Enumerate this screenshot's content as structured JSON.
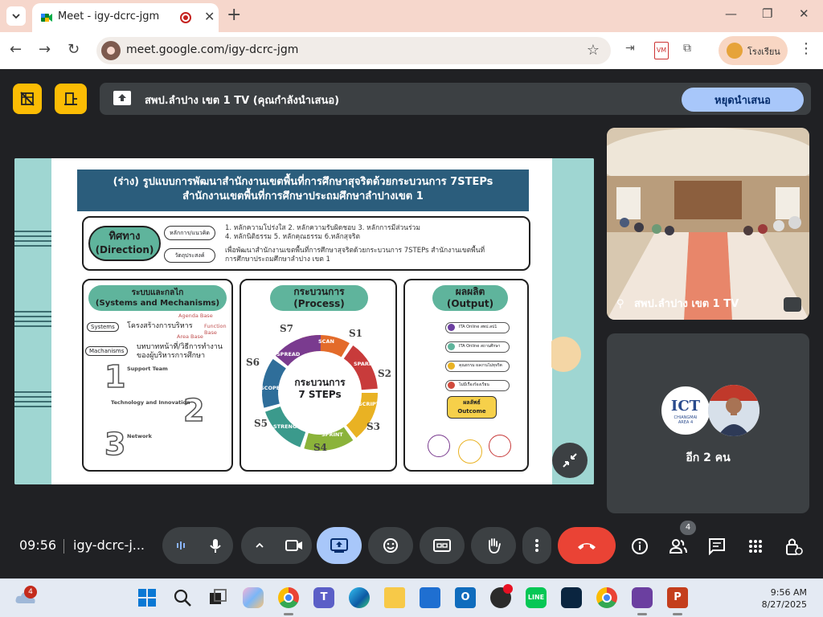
{
  "browser": {
    "tab_title": "Meet - igy-dcrc-jgm",
    "url": "meet.google.com/igy-dcrc-jgm",
    "profile_label": "โรงเรียน",
    "accent": "#f6d7cc"
  },
  "meet": {
    "presenting_text": "สพป.ลำปาง เขต 1 TV (คุณกำลังนำเสนอ)",
    "stop_presenting_label": "หยุดนำเสนอ",
    "video_tile_name": "สพป.ลำปาง เขต 1 TV",
    "more_participants_label": "อีก 2 คน",
    "avatar_ict_text": "ICT",
    "avatar_ict_sub": "CHIANGMAI\nAREA 4",
    "clock": "09:56",
    "meeting_code": "igy-dcrc-j...",
    "people_count": "4"
  },
  "slide": {
    "title_line1": "(ร่าง) รูปแบบการพัฒนาสำนักงานเขตพื้นที่การศึกษาสุจริตด้วยกระบวนการ 7STEPs",
    "title_line2": "สำนักงานเขตพื้นที่การศึกษาประถมศึกษาลำปางเขต 1",
    "direction_th": "ทิศทาง",
    "direction_en": "(Direction)",
    "principles_tag": "หลักการ/แนวคิด",
    "principles_line1": "1. หลักความโปร่งใส 2. หลักความรับผิดชอบ 3. หลักการมีส่วนร่วม",
    "principles_line2": "4. หลักนิติธรรม 5. หลักคุณธรรม 6.หลักสุจริต",
    "objective_tag": "วัตถุประสงค์",
    "objective_line1": "เพื่อพัฒนาสำนักงานเขตพื้นที่การศึกษาสุจริตด้วยกระบวนการ 7STEPs สำนักงานเขตพื้นที่",
    "objective_line2": "การศึกษาประถมศึกษาลำปาง เขต 1",
    "systems_th": "ระบบและกลไก",
    "systems_en": "(Systems and Mechanisms)",
    "systems_tag": "Systems",
    "systems_text": "โครงสร้างการบริหาร",
    "agenda_base": "Agenda Base",
    "function_base": "Function Base",
    "area_base": "Area Base",
    "mechanisms_tag": "Machanisms",
    "mechanisms_text1": "บทบาทหน้าที่/วิธีการทำงาน",
    "mechanisms_text2": "ของผู้บริหารการศึกษา",
    "support_team": "Support Team",
    "tech_innovation": "Technology and Innovation",
    "network": "Network",
    "process_th": "กระบวนการ",
    "process_en": "(Process)",
    "process_center_1": "กระบวนการ",
    "process_center_2": "7 STEPs",
    "steps": [
      "S1",
      "S2",
      "S3",
      "S4",
      "S5",
      "S6",
      "S7"
    ],
    "step_words": [
      "SCAN",
      "SPARK",
      "SCRIPT",
      "SPRINT",
      "STRENGTHEN",
      "SCOPE",
      "SPREAD"
    ],
    "output_th": "ผลผลิต",
    "output_en": "(Output)",
    "outputs": [
      "ITA Online สพป.ลป1",
      "ITA Online สถานศึกษา",
      "คุณธรรม ผลงานไม่ทุจริต",
      "ไม่มีเรื่องร้องเรียน"
    ],
    "outcome_th": "ผลลัพธ์",
    "outcome_en": "Outcome",
    "num1": "1",
    "num2": "2",
    "num3": "3"
  },
  "taskbar": {
    "weather_badge": "4",
    "time": "9:56 AM",
    "date": "8/27/2025"
  }
}
